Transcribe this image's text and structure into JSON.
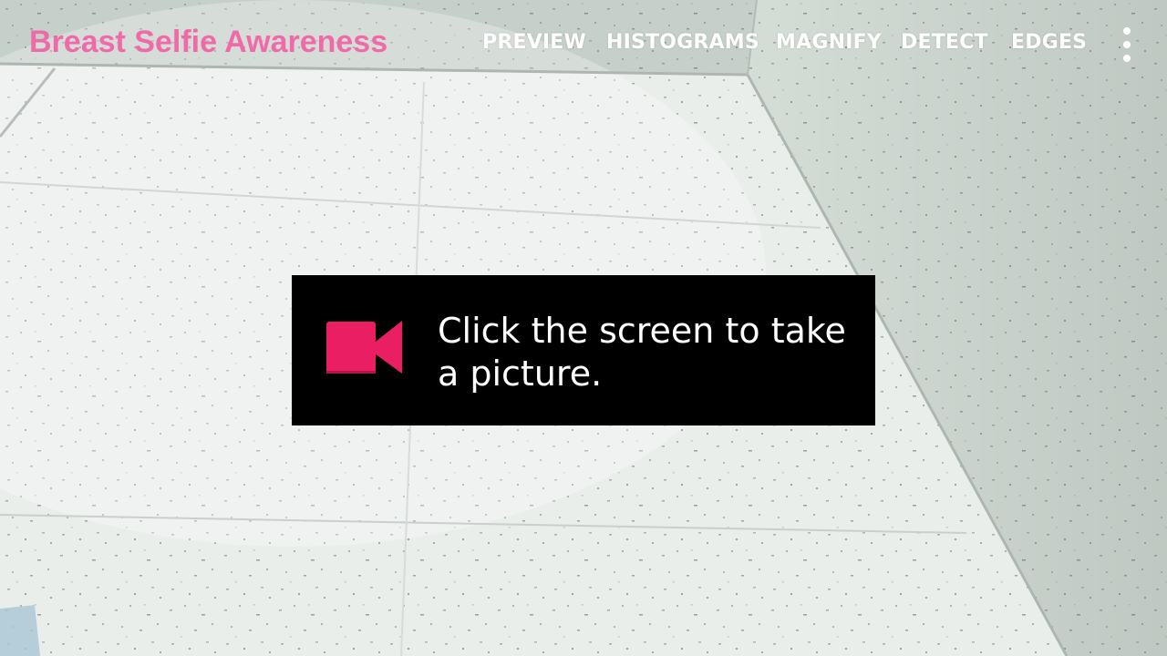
{
  "app": {
    "title": "Breast Selfie Awareness"
  },
  "action_bar": {
    "items": [
      {
        "label": "PREVIEW"
      },
      {
        "label": "HISTOGRAMS"
      },
      {
        "label": "MAGNIFY"
      },
      {
        "label": "DETECT"
      },
      {
        "label": "EDGES"
      }
    ],
    "overflow_icon": "more-vert-icon"
  },
  "toast": {
    "icon": "videocam-icon",
    "message": "Click the screen to take a picture."
  },
  "colors": {
    "accent_pink": "#f06aa8",
    "icon_pink": "#e91e63",
    "toast_background": "#000000",
    "action_text": "#ffffff"
  }
}
